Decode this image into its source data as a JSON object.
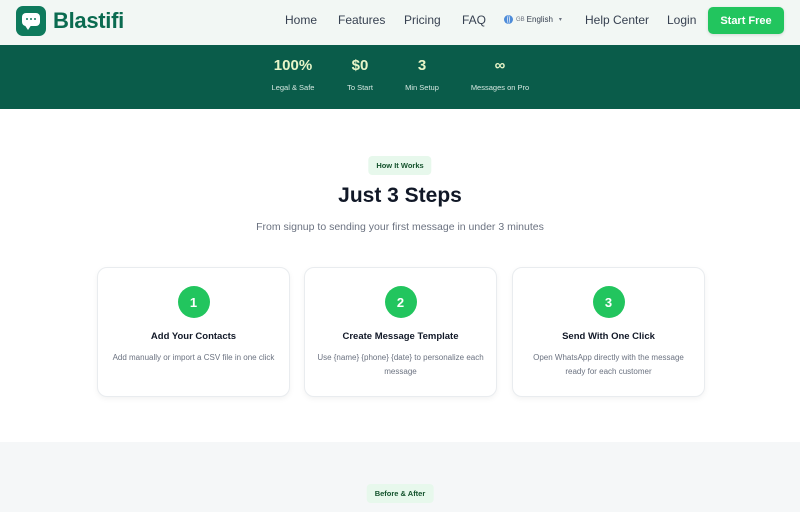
{
  "header": {
    "brand": "Blastifi",
    "nav": {
      "home": "Home",
      "features": "Features",
      "pricing": "Pricing",
      "faq": "FAQ",
      "language": "English",
      "language_prefix": "GB",
      "help": "Help Center",
      "login": "Login"
    },
    "cta": "Start Free"
  },
  "stats": [
    {
      "value": "100%",
      "label": "Legal & Safe"
    },
    {
      "value": "$0",
      "label": "To Start"
    },
    {
      "value": "3",
      "label": "Min Setup"
    },
    {
      "value": "∞",
      "label": "Messages on Pro"
    }
  ],
  "how_it_works": {
    "badge": "How It Works",
    "title": "Just 3 Steps",
    "subtitle": "From signup to sending your first message in under 3 minutes",
    "steps": [
      {
        "number": "1",
        "title": "Add Your Contacts",
        "description": "Add manually or import a CSV file in one click"
      },
      {
        "number": "2",
        "title": "Create Message Template",
        "description": "Use {name} {phone} {date} to personalize each message"
      },
      {
        "number": "3",
        "title": "Send With One Click",
        "description": "Open WhatsApp directly with the message ready for each customer"
      }
    ]
  },
  "before_after": {
    "badge": "Before & After"
  },
  "colors": {
    "brand_dark": "#0a5c4a",
    "accent_green": "#22c55e",
    "badge_bg": "#e7f8ec"
  }
}
